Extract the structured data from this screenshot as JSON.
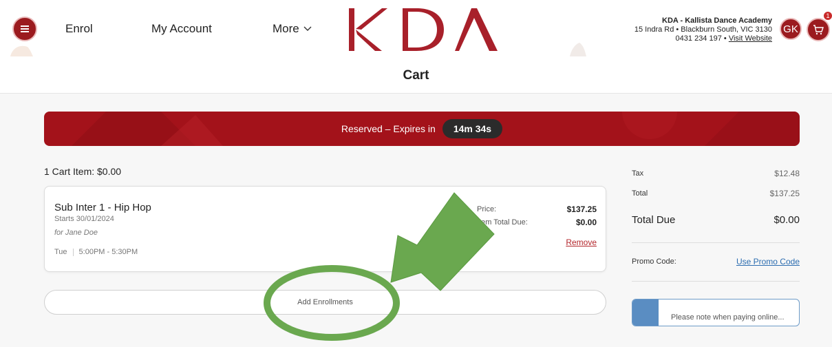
{
  "header": {
    "nav": {
      "enrol": "Enrol",
      "my_account": "My Account",
      "more": "More"
    },
    "logo_text": "KDA",
    "academy": {
      "name": "KDA - Kallista Dance Academy",
      "address": "15 Indra Rd • Blackburn South, VIC 3130",
      "phone": "0431 234 197 •",
      "website_link": "Visit Website"
    },
    "avatar_initials": "GK",
    "cart_badge": "1"
  },
  "page": {
    "title": "Cart"
  },
  "banner": {
    "text": "Reserved – Expires in",
    "timer": "14m 34s"
  },
  "cart": {
    "count_label": "1 Cart Item: $0.00",
    "item": {
      "name": "Sub Inter 1 - Hip Hop",
      "starts": "Starts 30/01/2024",
      "for": "for Jane Doe",
      "day": "Tue",
      "time": "5:00PM - 5:30PM",
      "price_label": "Price:",
      "price_value": "$137.25",
      "total_due_label": "Item Total Due:",
      "total_due_value": "$0.00",
      "remove": "Remove"
    },
    "add_button": "Add Enrollments"
  },
  "summary": {
    "tax_label": "Tax",
    "tax_value": "$12.48",
    "total_label": "Total",
    "total_value": "$137.25",
    "total_due_label": "Total Due",
    "total_due_value": "$0.00",
    "promo_label": "Promo Code:",
    "promo_link": "Use Promo Code",
    "note_text": "Please note when paying online..."
  },
  "colors": {
    "brand": "#9b1b1f",
    "banner": "#a3121a",
    "link": "#2b6cb0",
    "annotation": "#6aa84f"
  }
}
